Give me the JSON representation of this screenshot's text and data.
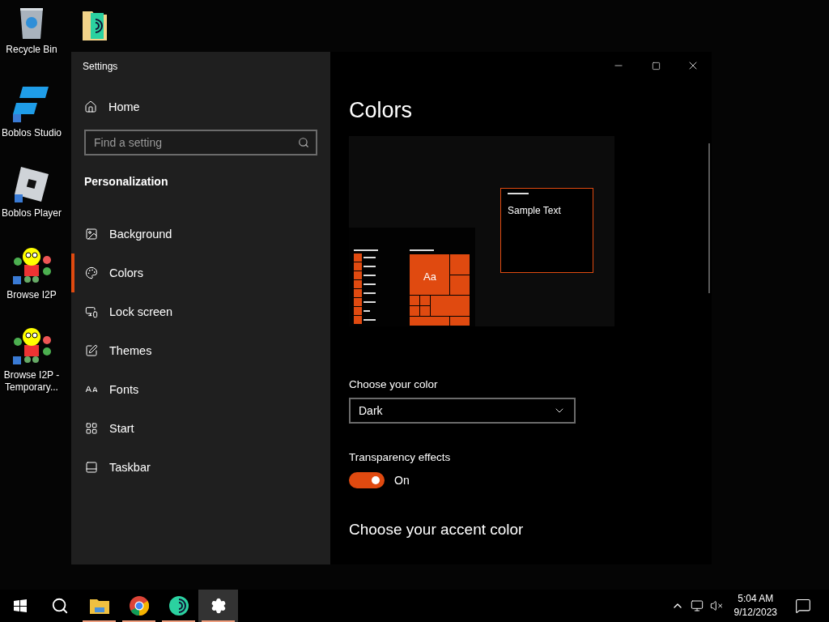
{
  "desktop_icons": [
    {
      "kind": "recycle",
      "label": "Recycle Bin"
    },
    {
      "kind": "studio",
      "label": "Boblos Studio"
    },
    {
      "kind": "player",
      "label": "Boblos Player"
    },
    {
      "kind": "i2p",
      "label": "Browse I2P"
    },
    {
      "kind": "i2p",
      "label": "Browse I2P - Temporary..."
    },
    {
      "kind": "folder"
    }
  ],
  "window": {
    "title": "Settings"
  },
  "sidebar": {
    "home": "Home",
    "search": {
      "placeholder": "Find a setting"
    },
    "section": "Personalization",
    "items": [
      {
        "kind": "background",
        "label": "Background",
        "selected": false
      },
      {
        "kind": "colors",
        "label": "Colors",
        "selected": true
      },
      {
        "kind": "lock",
        "label": "Lock screen",
        "selected": false
      },
      {
        "kind": "themes",
        "label": "Themes",
        "selected": false
      },
      {
        "kind": "fonts",
        "label": "Fonts",
        "selected": false
      },
      {
        "kind": "start",
        "label": "Start",
        "selected": false
      },
      {
        "kind": "taskbar",
        "label": "Taskbar",
        "selected": false
      }
    ]
  },
  "content": {
    "heading": "Colors",
    "preview": {
      "tile_text": "Aa",
      "sample_text": "Sample Text"
    },
    "color_label": "Choose your color",
    "color_value": "Dark",
    "transparency_label": "Transparency effects",
    "transparency": {
      "on": true,
      "label": "On"
    },
    "accent_heading": "Choose your accent color"
  },
  "taskbar": {
    "items": [
      {
        "kind": "start",
        "running": false,
        "selected": false
      },
      {
        "kind": "search",
        "running": false,
        "selected": false
      },
      {
        "kind": "explorer",
        "running": true,
        "selected": false
      },
      {
        "kind": "chrome",
        "running": true,
        "selected": false
      },
      {
        "kind": "tor",
        "running": true,
        "selected": false
      },
      {
        "kind": "settings",
        "running": true,
        "selected": true
      }
    ],
    "time": "5:04 AM",
    "date": "9/12/2023"
  }
}
